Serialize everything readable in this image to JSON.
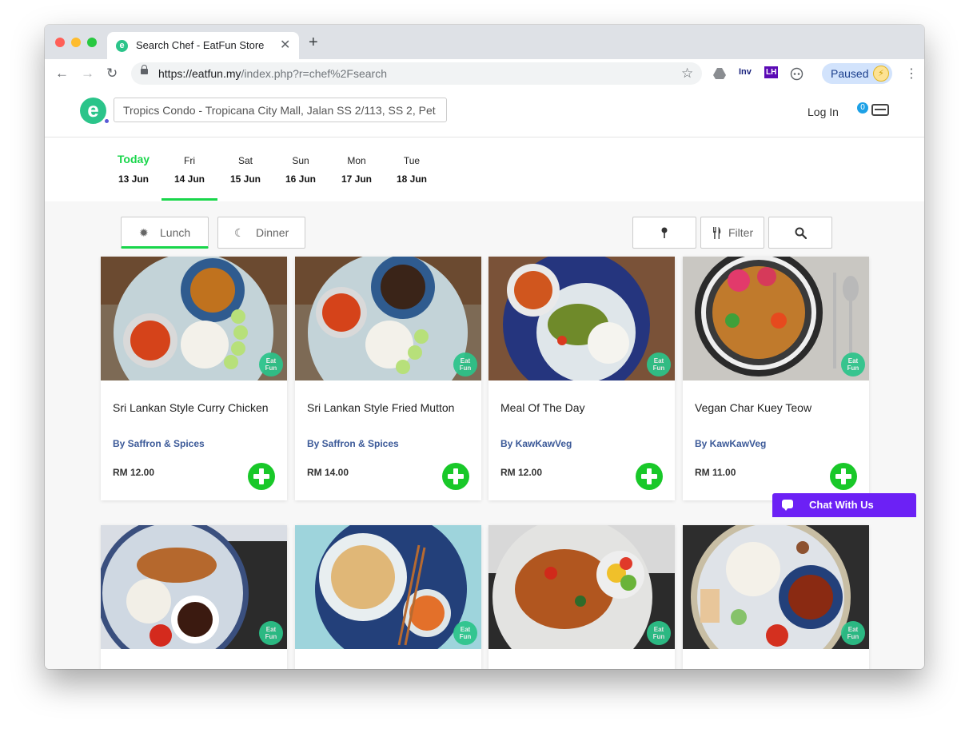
{
  "browser": {
    "tab_title": "Search Chef - EatFun Store",
    "tab_favicon_letter": "e",
    "url_host": "https://eatfun.my",
    "url_path": "/index.php?r=chef%2Fsearch",
    "extensions": [
      "Inv",
      "LH"
    ],
    "profile_status": "Paused"
  },
  "header": {
    "logo_letter": "e",
    "address": "Tropics Condo - Tropicana City Mall, Jalan SS 2/113, SS 2, Pet",
    "login_label": "Log In",
    "cart_count": "0"
  },
  "days": [
    {
      "name": "Today",
      "date": "13 Jun"
    },
    {
      "name": "Fri",
      "date": "14 Jun"
    },
    {
      "name": "Sat",
      "date": "15 Jun"
    },
    {
      "name": "Sun",
      "date": "16 Jun"
    },
    {
      "name": "Mon",
      "date": "17 Jun"
    },
    {
      "name": "Tue",
      "date": "18 Jun"
    }
  ],
  "active_day": 1,
  "filters": {
    "lunch_label": "Lunch",
    "dinner_label": "Dinner",
    "filter_label": "Filter"
  },
  "badge": {
    "line1": "Eat",
    "line2": "Fun"
  },
  "dishes": [
    {
      "name": "Sri Lankan Style Curry Chicken",
      "chef": "By Saffron & Spices",
      "price": "RM 12.00"
    },
    {
      "name": "Sri Lankan Style Fried Mutton",
      "chef": "By Saffron & Spices",
      "price": "RM 14.00"
    },
    {
      "name": "Meal Of The Day",
      "chef": "By KawKawVeg",
      "price": "RM 12.00"
    },
    {
      "name": "Vegan Char Kuey Teow",
      "chef": "By KawKawVeg",
      "price": "RM 11.00"
    }
  ],
  "chat": {
    "label": "Chat With Us"
  },
  "colors": {
    "brand_green": "#2bc48a",
    "accent_green": "#19d64b",
    "add_button_green": "#19c829",
    "chef_link": "#3b5998",
    "chat_purple": "#6c21f5"
  }
}
